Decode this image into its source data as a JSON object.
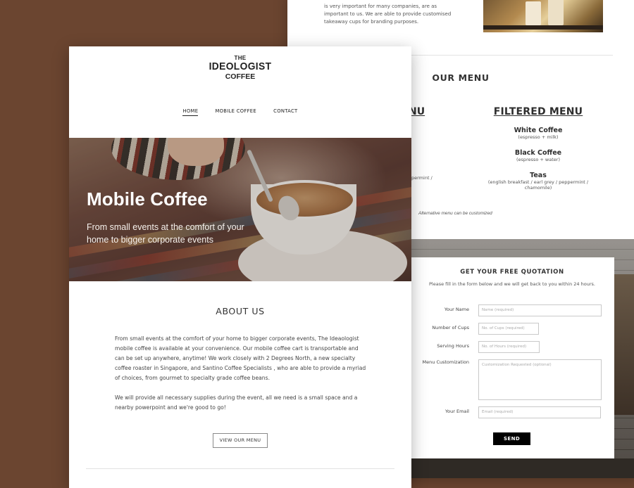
{
  "back_page": {
    "intro_text": "is very important for many companies, are as important to us. We are able to provide customised takeaway cups for branding purposes.",
    "menu_title": "OUR MENU",
    "left_heading_peek": "NU",
    "left_item_peek": "permint /",
    "filtered_menu": {
      "heading": "FILTERED MENU",
      "items": [
        {
          "name": "White Coffee",
          "desc": "(espresso + milk)"
        },
        {
          "name": "Black Coffee",
          "desc": "(espresso + water)"
        },
        {
          "name": "Teas",
          "desc": "(english breakfast / earl grey / peppermint / chamomile)"
        }
      ]
    },
    "alt_note": "Alternative menu can be customized"
  },
  "quotation_form": {
    "title": "GET YOUR FREE QUOTATION",
    "subtitle": "Please fill in the form below and we will get back to you within 24 hours.",
    "fields": {
      "name": {
        "label": "Your Name",
        "placeholder": "Name (required)"
      },
      "cups": {
        "label": "Number of Cups",
        "placeholder": "No. of Cups (required)"
      },
      "hours": {
        "label": "Serving Hours",
        "placeholder": "No. of Hours (required)"
      },
      "customization": {
        "label": "Menu Customization",
        "placeholder": "Customization Requested (optional)"
      },
      "email": {
        "label": "Your Email",
        "placeholder": "Email (required)"
      }
    },
    "send_label": "SEND"
  },
  "front_page": {
    "logo": {
      "line1": "THE",
      "line2": "IDEOLOGIST",
      "line3": "COFFEE"
    },
    "nav": [
      {
        "label": "HOME",
        "active": true
      },
      {
        "label": "MOBILE COFFEE",
        "active": false
      },
      {
        "label": "CONTACT",
        "active": false
      }
    ],
    "hero": {
      "title": "Mobile Coffee",
      "subtitle": "From small events at the comfort of your home to bigger corporate events"
    },
    "about": {
      "title": "ABOUT US",
      "paragraph1": "From small events at the comfort of your home to bigger corporate events, The Ideaologist mobile coffee is available at your convenience. Our mobile coffee cart is transportable and can be set up anywhere, anytime! We work closely with 2 Degrees North, a new specialty coffee roaster in Singapore, and Santino Coffee Specialists , who are able to provide a myriad of choices, from gourmet to specialty grade coffee beans.",
      "paragraph2": "We will provide all necessary supplies during the event, all we need is a small space and a nearby powerpoint and we're good to go!",
      "button_label": "VIEW OUR MENU"
    }
  },
  "colors": {
    "background": "#6b4530",
    "button_dark": "#000000",
    "text_dark": "#333333"
  }
}
